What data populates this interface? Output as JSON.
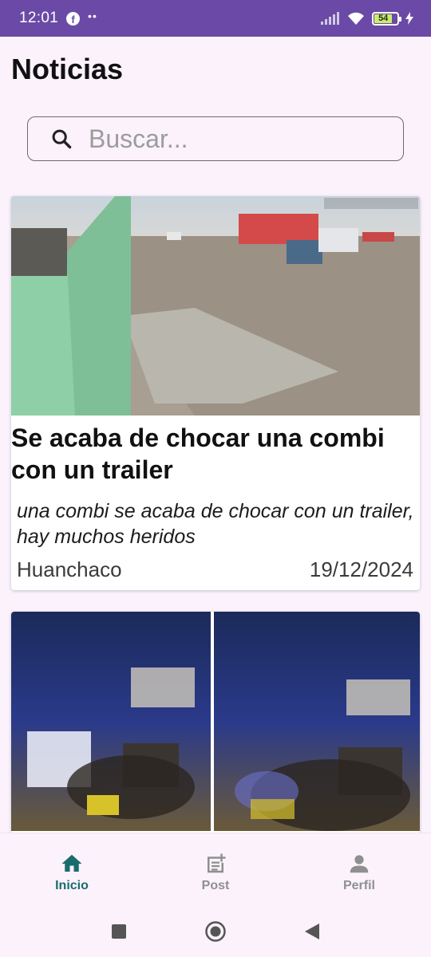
{
  "status_bar": {
    "time": "12:01",
    "notification_icons": [
      "facebook-icon",
      "more-dots-icon"
    ],
    "battery_level": "54",
    "background_color": "#6a4aa6"
  },
  "header": {
    "title": "Noticias"
  },
  "search": {
    "placeholder": "Buscar..."
  },
  "posts": [
    {
      "title": "Se acaba de chocar una combi con un trailer",
      "description": "una combi se acaba de chocar con un trailer, hay muchos heridos",
      "location": "Huanchaco",
      "date": "19/12/2024"
    },
    {
      "title": "",
      "description": "",
      "location": "",
      "date": ""
    }
  ],
  "bottom_nav": {
    "items": [
      {
        "label": "Inicio",
        "icon": "home-icon",
        "active": true
      },
      {
        "label": "Post",
        "icon": "post-add-icon",
        "active": false
      },
      {
        "label": "Perfil",
        "icon": "person-icon",
        "active": false
      }
    ],
    "active_color": "#186c6e",
    "inactive_color": "#8f8f8f"
  },
  "system_nav": {
    "icons": [
      "recents-square-icon",
      "home-circle-icon",
      "back-triangle-icon"
    ]
  }
}
